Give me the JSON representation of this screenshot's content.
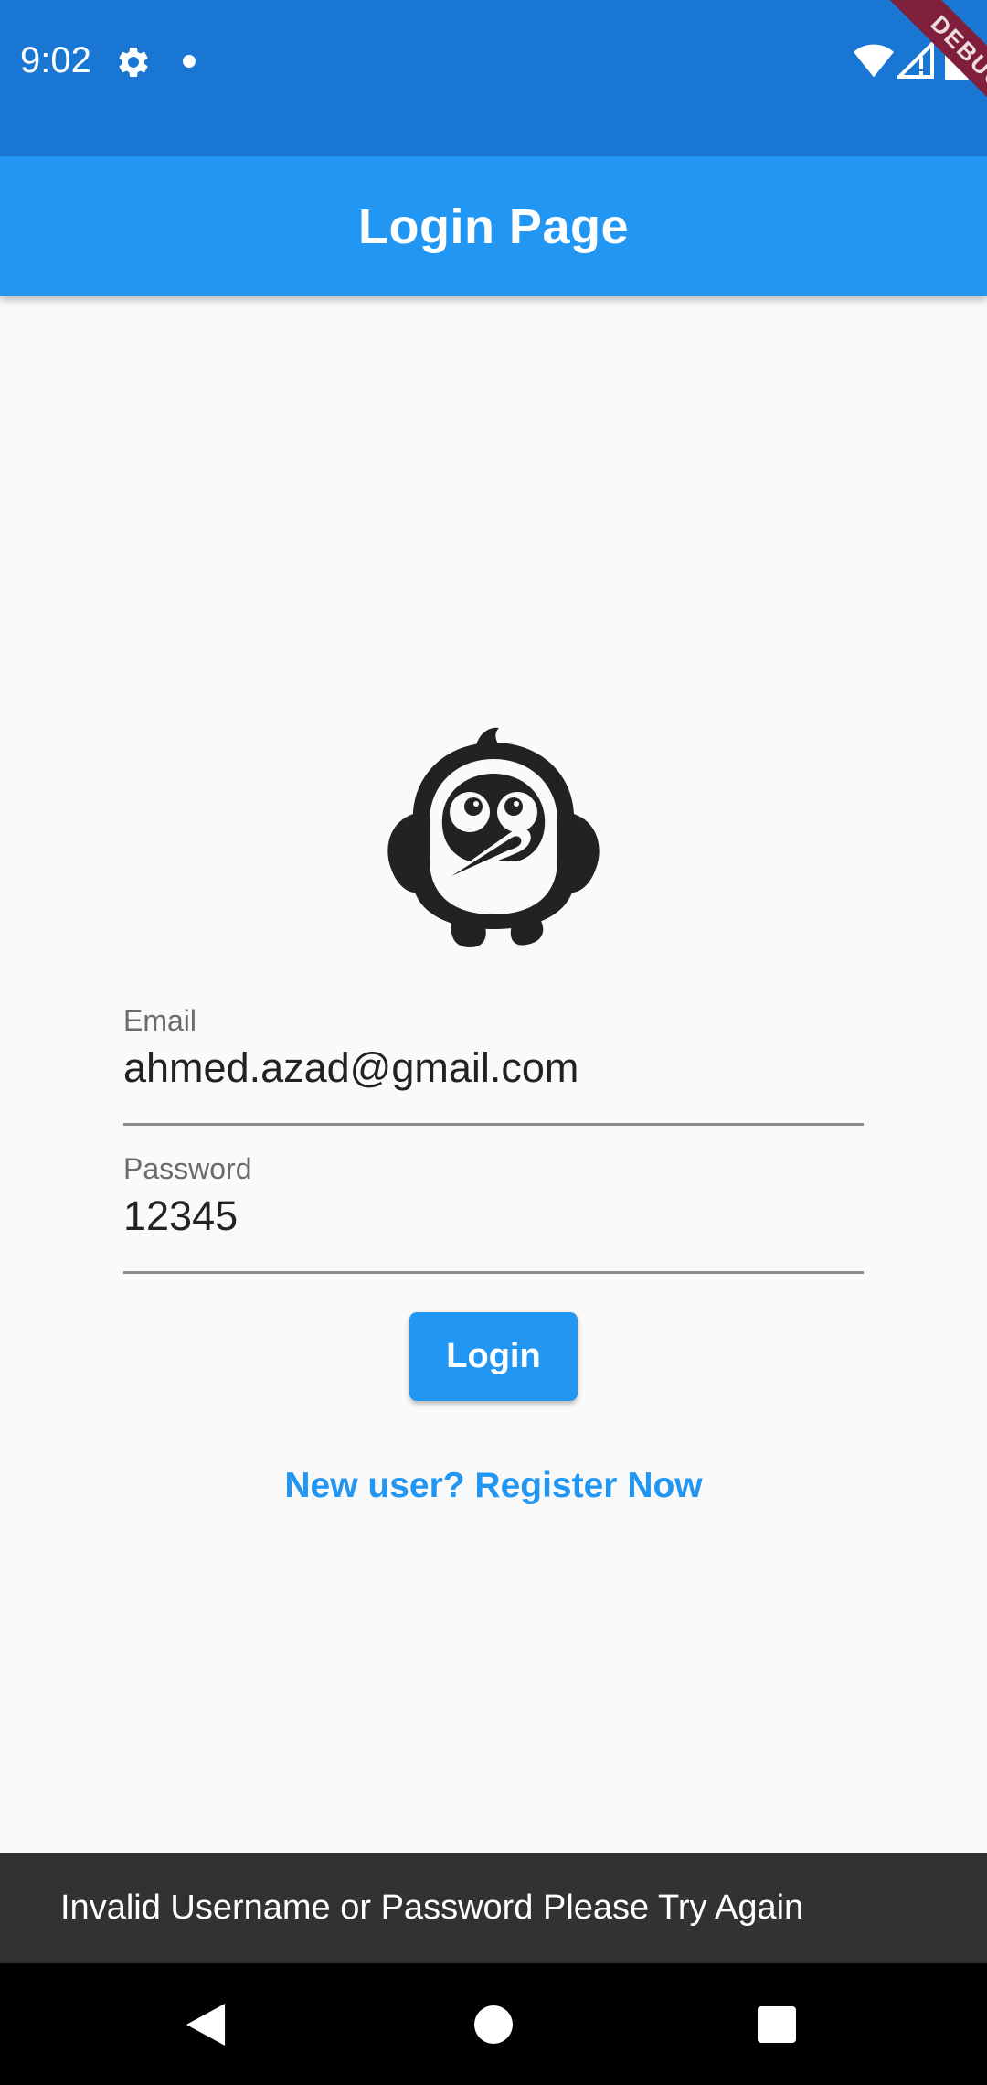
{
  "status_bar": {
    "time": "9:02",
    "icons": [
      "gear-icon",
      "notification-dot-icon",
      "wifi-icon",
      "signal-icon",
      "battery-icon"
    ],
    "debug_banner": "DEBUG",
    "color": "#1976d2"
  },
  "app_bar": {
    "title": "Login Page",
    "color": "#2196f3"
  },
  "logo": {
    "icon": "penguin-logo-icon"
  },
  "form": {
    "email": {
      "label": "Email",
      "value": "ahmed.azad@gmail.com"
    },
    "password": {
      "label": "Password",
      "value": "12345"
    },
    "login_label": "Login",
    "register_link": "New user? Register Now"
  },
  "snackbar": {
    "message": "Invalid Username or Password Please Try Again"
  },
  "nav_bar": {
    "icons": [
      "back-icon",
      "home-icon",
      "recents-icon"
    ]
  }
}
